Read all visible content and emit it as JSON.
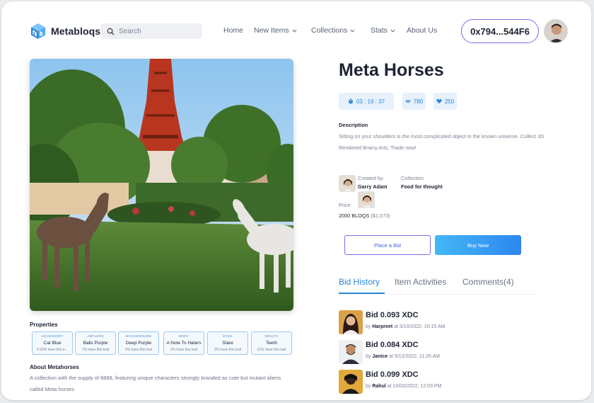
{
  "header": {
    "brand": "Metabloqs",
    "search_placeholder": "Search",
    "nav": [
      {
        "label": "Home",
        "has_dropdown": false
      },
      {
        "label": "New Items",
        "has_dropdown": true
      },
      {
        "label": "Collections",
        "has_dropdown": true
      },
      {
        "label": "Stats",
        "has_dropdown": true
      },
      {
        "label": "About Us",
        "has_dropdown": false
      }
    ],
    "wallet": "0x794...544F6"
  },
  "item": {
    "title": "Meta Horses",
    "timer": "03 : 19 : 37",
    "views": "780",
    "likes": "250",
    "description_title": "Description",
    "description": "Sitting on your shoulders is the most complicated object in the known universe. Collect 3D Rendered Brainy Arts. Trade now!",
    "created_by_label": "Created by",
    "creator": "Garry Adam",
    "collection_label": "Collection",
    "collection": "Food  for thought",
    "price_label": "Price",
    "price": "2000 BLOQS",
    "price_usd": "($1,073)",
    "place_bid": "Place a Bid",
    "buy_now": "Buy Now"
  },
  "tabs": [
    "Bid History",
    "Item Activities",
    "Comments(4)"
  ],
  "bids": [
    {
      "amount": "Bid 0.093 XDC",
      "by": "by",
      "user": "Harpreet",
      "at": "at 3/10/2022, 10:15 AM"
    },
    {
      "amount": "Bid 0.084 XDC",
      "by": "by",
      "user": "Janice",
      "at": "at 5/12/2022, 11:26 AM"
    },
    {
      "amount": "Bid 0.099 XDC",
      "by": "by",
      "user": "Rahul",
      "at": "at 10/03/2022, 12:03 PM"
    }
  ],
  "properties_title": "Properties",
  "properties": [
    {
      "type": "Accessory",
      "value": "Cat Blue",
      "share": "0.93% have this tr..."
    },
    {
      "type": "Antlers",
      "value": "Balls Purple",
      "share": "7% have this trait"
    },
    {
      "type": "Background",
      "value": "Deep Purple",
      "share": "9% have this trait"
    },
    {
      "type": "Body",
      "value": "A Note To Haters",
      "share": "2% have this trait"
    },
    {
      "type": "Eyes",
      "value": "Stare",
      "share": "3% have this trait"
    },
    {
      "type": "Mouth",
      "value": "Teeth",
      "share": "12% have this trait"
    }
  ],
  "about": {
    "title": "About Metahorses",
    "text": "A collection with the supply of 8888, featuring unique characters strongly branded as cute but mutant aliens called Meta horses"
  },
  "colors": {
    "accent": "#2f86d9",
    "wallet_border": "#7b6fe3",
    "buy_gradient_start": "#44b8f6",
    "buy_gradient_end": "#2d86f0"
  }
}
